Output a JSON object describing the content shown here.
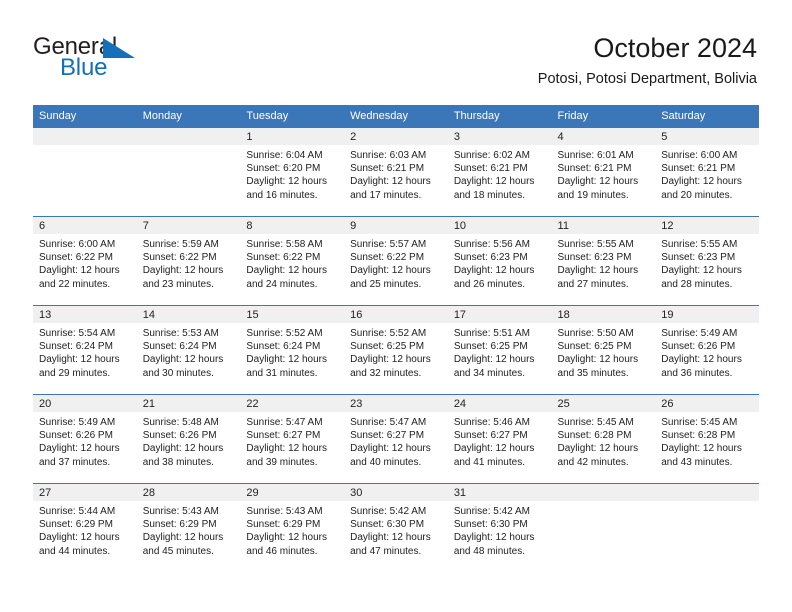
{
  "logo": {
    "primary_text": "General",
    "secondary_text": "Blue",
    "triangle_icon": "triangle-icon",
    "primary_color": "#231f20",
    "accent_color": "#1470b8"
  },
  "header": {
    "title": "October 2024",
    "subtitle": "Potosi, Potosi Department, Bolivia"
  },
  "theme": {
    "header_row_bg": "#3a76b8",
    "day_band_bg": "#f0f0f0",
    "row_separator": "#3a76b8",
    "text_color": "#222222"
  },
  "calendar": {
    "weekdays": [
      "Sunday",
      "Monday",
      "Tuesday",
      "Wednesday",
      "Thursday",
      "Friday",
      "Saturday"
    ],
    "weeks": [
      [
        {
          "day": "",
          "empty": true
        },
        {
          "day": "",
          "empty": true
        },
        {
          "day": "1",
          "sunrise": "Sunrise: 6:04 AM",
          "sunset": "Sunset: 6:20 PM",
          "daylight_1": "Daylight: 12 hours",
          "daylight_2": "and 16 minutes."
        },
        {
          "day": "2",
          "sunrise": "Sunrise: 6:03 AM",
          "sunset": "Sunset: 6:21 PM",
          "daylight_1": "Daylight: 12 hours",
          "daylight_2": "and 17 minutes."
        },
        {
          "day": "3",
          "sunrise": "Sunrise: 6:02 AM",
          "sunset": "Sunset: 6:21 PM",
          "daylight_1": "Daylight: 12 hours",
          "daylight_2": "and 18 minutes."
        },
        {
          "day": "4",
          "sunrise": "Sunrise: 6:01 AM",
          "sunset": "Sunset: 6:21 PM",
          "daylight_1": "Daylight: 12 hours",
          "daylight_2": "and 19 minutes."
        },
        {
          "day": "5",
          "sunrise": "Sunrise: 6:00 AM",
          "sunset": "Sunset: 6:21 PM",
          "daylight_1": "Daylight: 12 hours",
          "daylight_2": "and 20 minutes."
        }
      ],
      [
        {
          "day": "6",
          "sunrise": "Sunrise: 6:00 AM",
          "sunset": "Sunset: 6:22 PM",
          "daylight_1": "Daylight: 12 hours",
          "daylight_2": "and 22 minutes."
        },
        {
          "day": "7",
          "sunrise": "Sunrise: 5:59 AM",
          "sunset": "Sunset: 6:22 PM",
          "daylight_1": "Daylight: 12 hours",
          "daylight_2": "and 23 minutes."
        },
        {
          "day": "8",
          "sunrise": "Sunrise: 5:58 AM",
          "sunset": "Sunset: 6:22 PM",
          "daylight_1": "Daylight: 12 hours",
          "daylight_2": "and 24 minutes."
        },
        {
          "day": "9",
          "sunrise": "Sunrise: 5:57 AM",
          "sunset": "Sunset: 6:22 PM",
          "daylight_1": "Daylight: 12 hours",
          "daylight_2": "and 25 minutes."
        },
        {
          "day": "10",
          "sunrise": "Sunrise: 5:56 AM",
          "sunset": "Sunset: 6:23 PM",
          "daylight_1": "Daylight: 12 hours",
          "daylight_2": "and 26 minutes."
        },
        {
          "day": "11",
          "sunrise": "Sunrise: 5:55 AM",
          "sunset": "Sunset: 6:23 PM",
          "daylight_1": "Daylight: 12 hours",
          "daylight_2": "and 27 minutes."
        },
        {
          "day": "12",
          "sunrise": "Sunrise: 5:55 AM",
          "sunset": "Sunset: 6:23 PM",
          "daylight_1": "Daylight: 12 hours",
          "daylight_2": "and 28 minutes."
        }
      ],
      [
        {
          "day": "13",
          "sunrise": "Sunrise: 5:54 AM",
          "sunset": "Sunset: 6:24 PM",
          "daylight_1": "Daylight: 12 hours",
          "daylight_2": "and 29 minutes."
        },
        {
          "day": "14",
          "sunrise": "Sunrise: 5:53 AM",
          "sunset": "Sunset: 6:24 PM",
          "daylight_1": "Daylight: 12 hours",
          "daylight_2": "and 30 minutes."
        },
        {
          "day": "15",
          "sunrise": "Sunrise: 5:52 AM",
          "sunset": "Sunset: 6:24 PM",
          "daylight_1": "Daylight: 12 hours",
          "daylight_2": "and 31 minutes."
        },
        {
          "day": "16",
          "sunrise": "Sunrise: 5:52 AM",
          "sunset": "Sunset: 6:25 PM",
          "daylight_1": "Daylight: 12 hours",
          "daylight_2": "and 32 minutes."
        },
        {
          "day": "17",
          "sunrise": "Sunrise: 5:51 AM",
          "sunset": "Sunset: 6:25 PM",
          "daylight_1": "Daylight: 12 hours",
          "daylight_2": "and 34 minutes."
        },
        {
          "day": "18",
          "sunrise": "Sunrise: 5:50 AM",
          "sunset": "Sunset: 6:25 PM",
          "daylight_1": "Daylight: 12 hours",
          "daylight_2": "and 35 minutes."
        },
        {
          "day": "19",
          "sunrise": "Sunrise: 5:49 AM",
          "sunset": "Sunset: 6:26 PM",
          "daylight_1": "Daylight: 12 hours",
          "daylight_2": "and 36 minutes."
        }
      ],
      [
        {
          "day": "20",
          "sunrise": "Sunrise: 5:49 AM",
          "sunset": "Sunset: 6:26 PM",
          "daylight_1": "Daylight: 12 hours",
          "daylight_2": "and 37 minutes."
        },
        {
          "day": "21",
          "sunrise": "Sunrise: 5:48 AM",
          "sunset": "Sunset: 6:26 PM",
          "daylight_1": "Daylight: 12 hours",
          "daylight_2": "and 38 minutes."
        },
        {
          "day": "22",
          "sunrise": "Sunrise: 5:47 AM",
          "sunset": "Sunset: 6:27 PM",
          "daylight_1": "Daylight: 12 hours",
          "daylight_2": "and 39 minutes."
        },
        {
          "day": "23",
          "sunrise": "Sunrise: 5:47 AM",
          "sunset": "Sunset: 6:27 PM",
          "daylight_1": "Daylight: 12 hours",
          "daylight_2": "and 40 minutes."
        },
        {
          "day": "24",
          "sunrise": "Sunrise: 5:46 AM",
          "sunset": "Sunset: 6:27 PM",
          "daylight_1": "Daylight: 12 hours",
          "daylight_2": "and 41 minutes."
        },
        {
          "day": "25",
          "sunrise": "Sunrise: 5:45 AM",
          "sunset": "Sunset: 6:28 PM",
          "daylight_1": "Daylight: 12 hours",
          "daylight_2": "and 42 minutes."
        },
        {
          "day": "26",
          "sunrise": "Sunrise: 5:45 AM",
          "sunset": "Sunset: 6:28 PM",
          "daylight_1": "Daylight: 12 hours",
          "daylight_2": "and 43 minutes."
        }
      ],
      [
        {
          "day": "27",
          "sunrise": "Sunrise: 5:44 AM",
          "sunset": "Sunset: 6:29 PM",
          "daylight_1": "Daylight: 12 hours",
          "daylight_2": "and 44 minutes."
        },
        {
          "day": "28",
          "sunrise": "Sunrise: 5:43 AM",
          "sunset": "Sunset: 6:29 PM",
          "daylight_1": "Daylight: 12 hours",
          "daylight_2": "and 45 minutes."
        },
        {
          "day": "29",
          "sunrise": "Sunrise: 5:43 AM",
          "sunset": "Sunset: 6:29 PM",
          "daylight_1": "Daylight: 12 hours",
          "daylight_2": "and 46 minutes."
        },
        {
          "day": "30",
          "sunrise": "Sunrise: 5:42 AM",
          "sunset": "Sunset: 6:30 PM",
          "daylight_1": "Daylight: 12 hours",
          "daylight_2": "and 47 minutes."
        },
        {
          "day": "31",
          "sunrise": "Sunrise: 5:42 AM",
          "sunset": "Sunset: 6:30 PM",
          "daylight_1": "Daylight: 12 hours",
          "daylight_2": "and 48 minutes."
        },
        {
          "day": "",
          "empty": true
        },
        {
          "day": "",
          "empty": true
        }
      ]
    ]
  }
}
